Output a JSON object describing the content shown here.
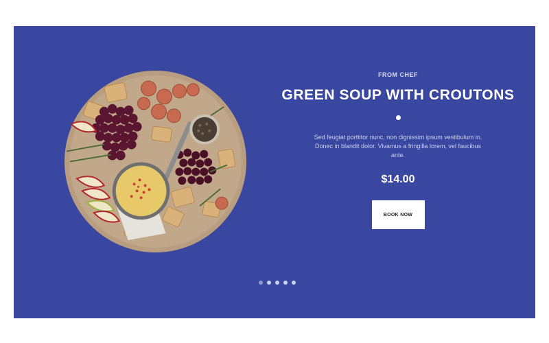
{
  "hero": {
    "eyebrow": "FROM CHEF",
    "title": "GREEN SOUP WITH CROUTONS",
    "description": "Sed feugiat porttitor nunc, non dignissim ipsum vestibulum in. Donec in blandit dolor. Vivamus a fringilla lorem, vel faucibus ante.",
    "price": "$14.00",
    "button_label": "BOOK NOW",
    "image_alt": "food platter"
  },
  "pager": {
    "count": 5,
    "active_index": 0
  },
  "colors": {
    "background": "#3a47a0",
    "text": "#ffffff",
    "button_bg": "#ffffff"
  }
}
